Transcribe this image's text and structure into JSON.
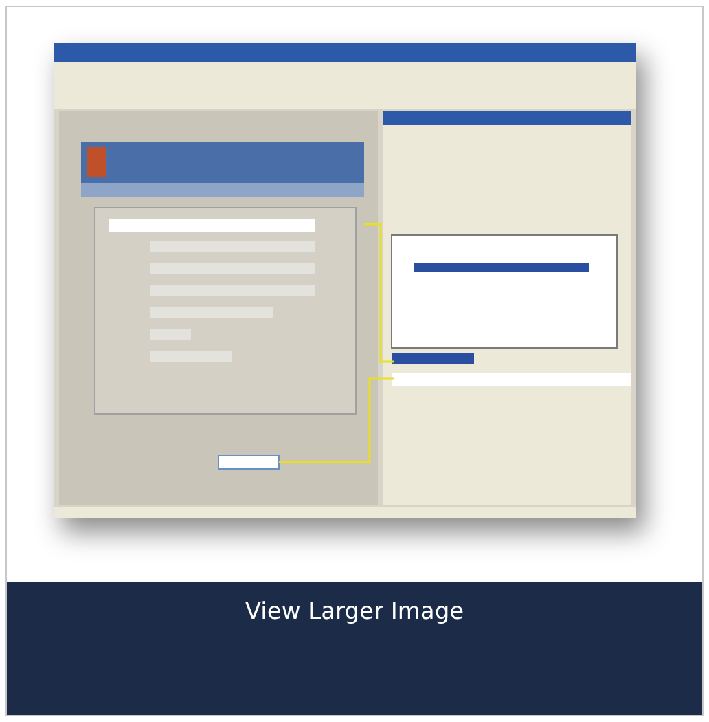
{
  "caption_bar": {
    "label": "View Larger Image"
  }
}
